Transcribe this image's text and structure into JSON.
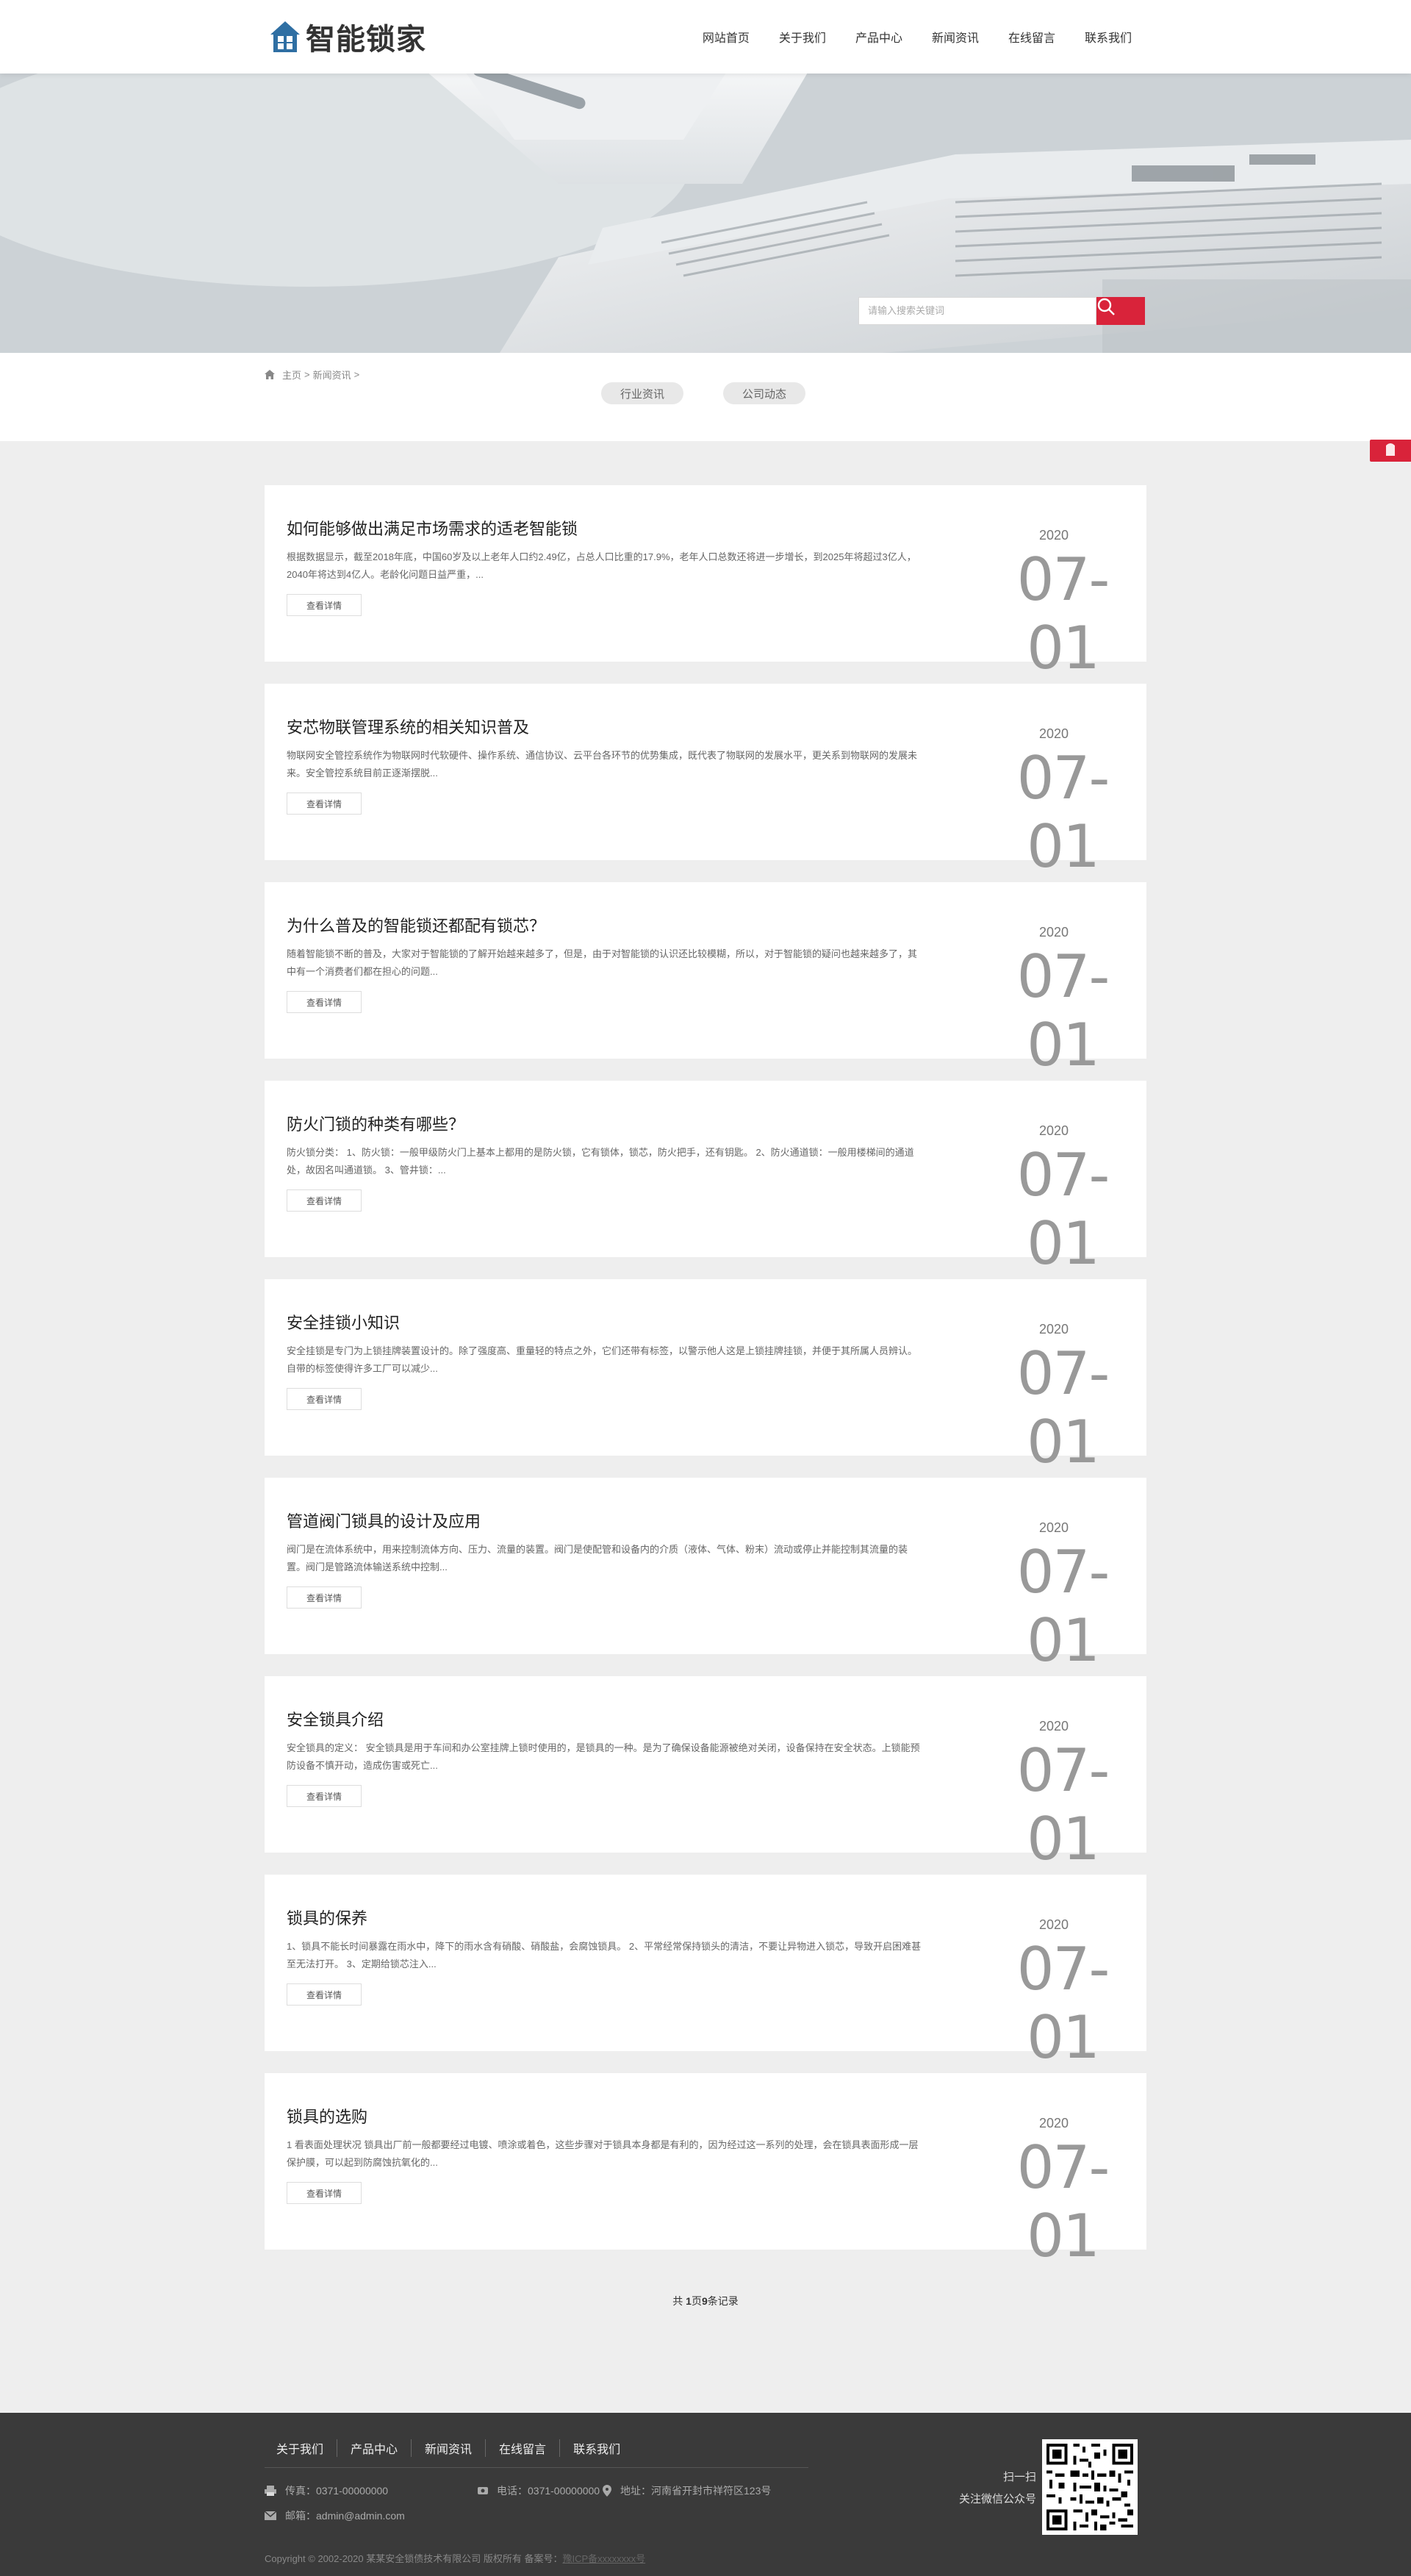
{
  "header": {
    "logo_text": "智能锁家",
    "nav": [
      "网站首页",
      "关于我们",
      "产品中心",
      "新闻资讯",
      "在线留言",
      "联系我们"
    ]
  },
  "search": {
    "placeholder": "请输入搜索关键词"
  },
  "breadcrumb": {
    "home": "主页",
    "sep1": ">",
    "current": "新闻资讯",
    "sep2": ">"
  },
  "tabs": [
    "行业资讯",
    "公司动态"
  ],
  "articles": [
    {
      "title": "如何能够做出满足市场需求的适老智能锁",
      "summary": "根据数据显示，截至2018年底，中国60岁及以上老年人口约2.49亿，占总人口比重的17.9%，老年人口总数还将进一步增长，到2025年将超过3亿人，2040年将达到4亿人。老龄化问题日益严重，...",
      "more": "查看详情",
      "year": "2020",
      "day": "07-01"
    },
    {
      "title": "安芯物联管理系统的相关知识普及",
      "summary": "物联网安全管控系统作为物联网时代软硬件、操作系统、通信协议、云平台各环节的优势集成，既代表了物联网的发展水平，更关系到物联网的发展未来。安全管控系统目前正逐渐摆脱...",
      "more": "查看详情",
      "year": "2020",
      "day": "07-01"
    },
    {
      "title": "为什么普及的智能锁还都配有锁芯？",
      "summary": "随着智能锁不断的普及，大家对于智能锁的了解开始越来越多了，但是，由于对智能锁的认识还比较模糊，所以，对于智能锁的疑问也越来越多了，其中有一个消费者们都在担心的问题...",
      "more": "查看详情",
      "year": "2020",
      "day": "07-01"
    },
    {
      "title": "防火门锁的种类有哪些？",
      "summary": "防火锁分类： 1、防火锁：一般甲级防火门上基本上都用的是防火锁，它有锁体，锁芯，防火把手，还有钥匙。 2、防火通道锁：一般用楼梯间的通道处，故因名叫通道锁。 3、管井锁：...",
      "more": "查看详情",
      "year": "2020",
      "day": "07-01"
    },
    {
      "title": "安全挂锁小知识",
      "summary": "安全挂锁是专门为上锁挂牌装置设计的。除了强度高、重量轻的特点之外，它们还带有标签，以警示他人这是上锁挂牌挂锁，并便于其所属人员辨认。自带的标签使得许多工厂可以减少...",
      "more": "查看详情",
      "year": "2020",
      "day": "07-01"
    },
    {
      "title": "管道阀门锁具的设计及应用",
      "summary": "阀门是在流体系统中，用来控制流体方向、压力、流量的装置。阀门是使配管和设备内的介质（液体、气体、粉末）流动或停止并能控制其流量的装置。阀门是管路流体输送系统中控制...",
      "more": "查看详情",
      "year": "2020",
      "day": "07-01"
    },
    {
      "title": "安全锁具介绍",
      "summary": "安全锁具的定义： 安全锁具是用于车间和办公室挂牌上锁时使用的，是锁具的一种。是为了确保设备能源被绝对关闭，设备保持在安全状态。上锁能预防设备不慎开动，造成伤害或死亡...",
      "more": "查看详情",
      "year": "2020",
      "day": "07-01"
    },
    {
      "title": "锁具的保养",
      "summary": "1、锁具不能长时间暴露在雨水中，降下的雨水含有硝酸、硝酸盐，会腐蚀锁具。 2、平常经常保持锁头的清洁，不要让异物进入锁芯，导致开启困难甚至无法打开。 3、定期给锁芯注入...",
      "more": "查看详情",
      "year": "2020",
      "day": "07-01"
    },
    {
      "title": "锁具的选购",
      "summary": "1 看表面处理状况 锁具出厂前一般都要经过电镀、喷涂或着色，这些步骤对于锁具本身都是有利的，因为经过这一系列的处理，会在锁具表面形成一层保护膜，可以起到防腐蚀抗氧化的...",
      "more": "查看详情",
      "year": "2020",
      "day": "07-01"
    }
  ],
  "pager": {
    "prefix": "共",
    "count": "1",
    "mid": "页",
    "records": "9",
    "suffix": "条记录"
  },
  "footer": {
    "nav": [
      "关于我们",
      "产品中心",
      "新闻资讯",
      "在线留言",
      "联系我们"
    ],
    "fax": "传真：0371-00000000",
    "phone": "电话：0371-00000000",
    "address": "地址：河南省开封市祥符区123号",
    "email": "邮箱：admin@admin.com",
    "copyright": "Copyright © 2002-2020 某某安全锁债技术有限公司 版权所有 备案号：",
    "icp": "豫ICP备xxxxxxxx号",
    "qr_line1": "扫一扫",
    "qr_line2": "关注微信公众号"
  },
  "colors": {
    "accent": "#d9233a",
    "footer_bg": "#3a3a3a",
    "page_bg": "#eeeeee"
  }
}
